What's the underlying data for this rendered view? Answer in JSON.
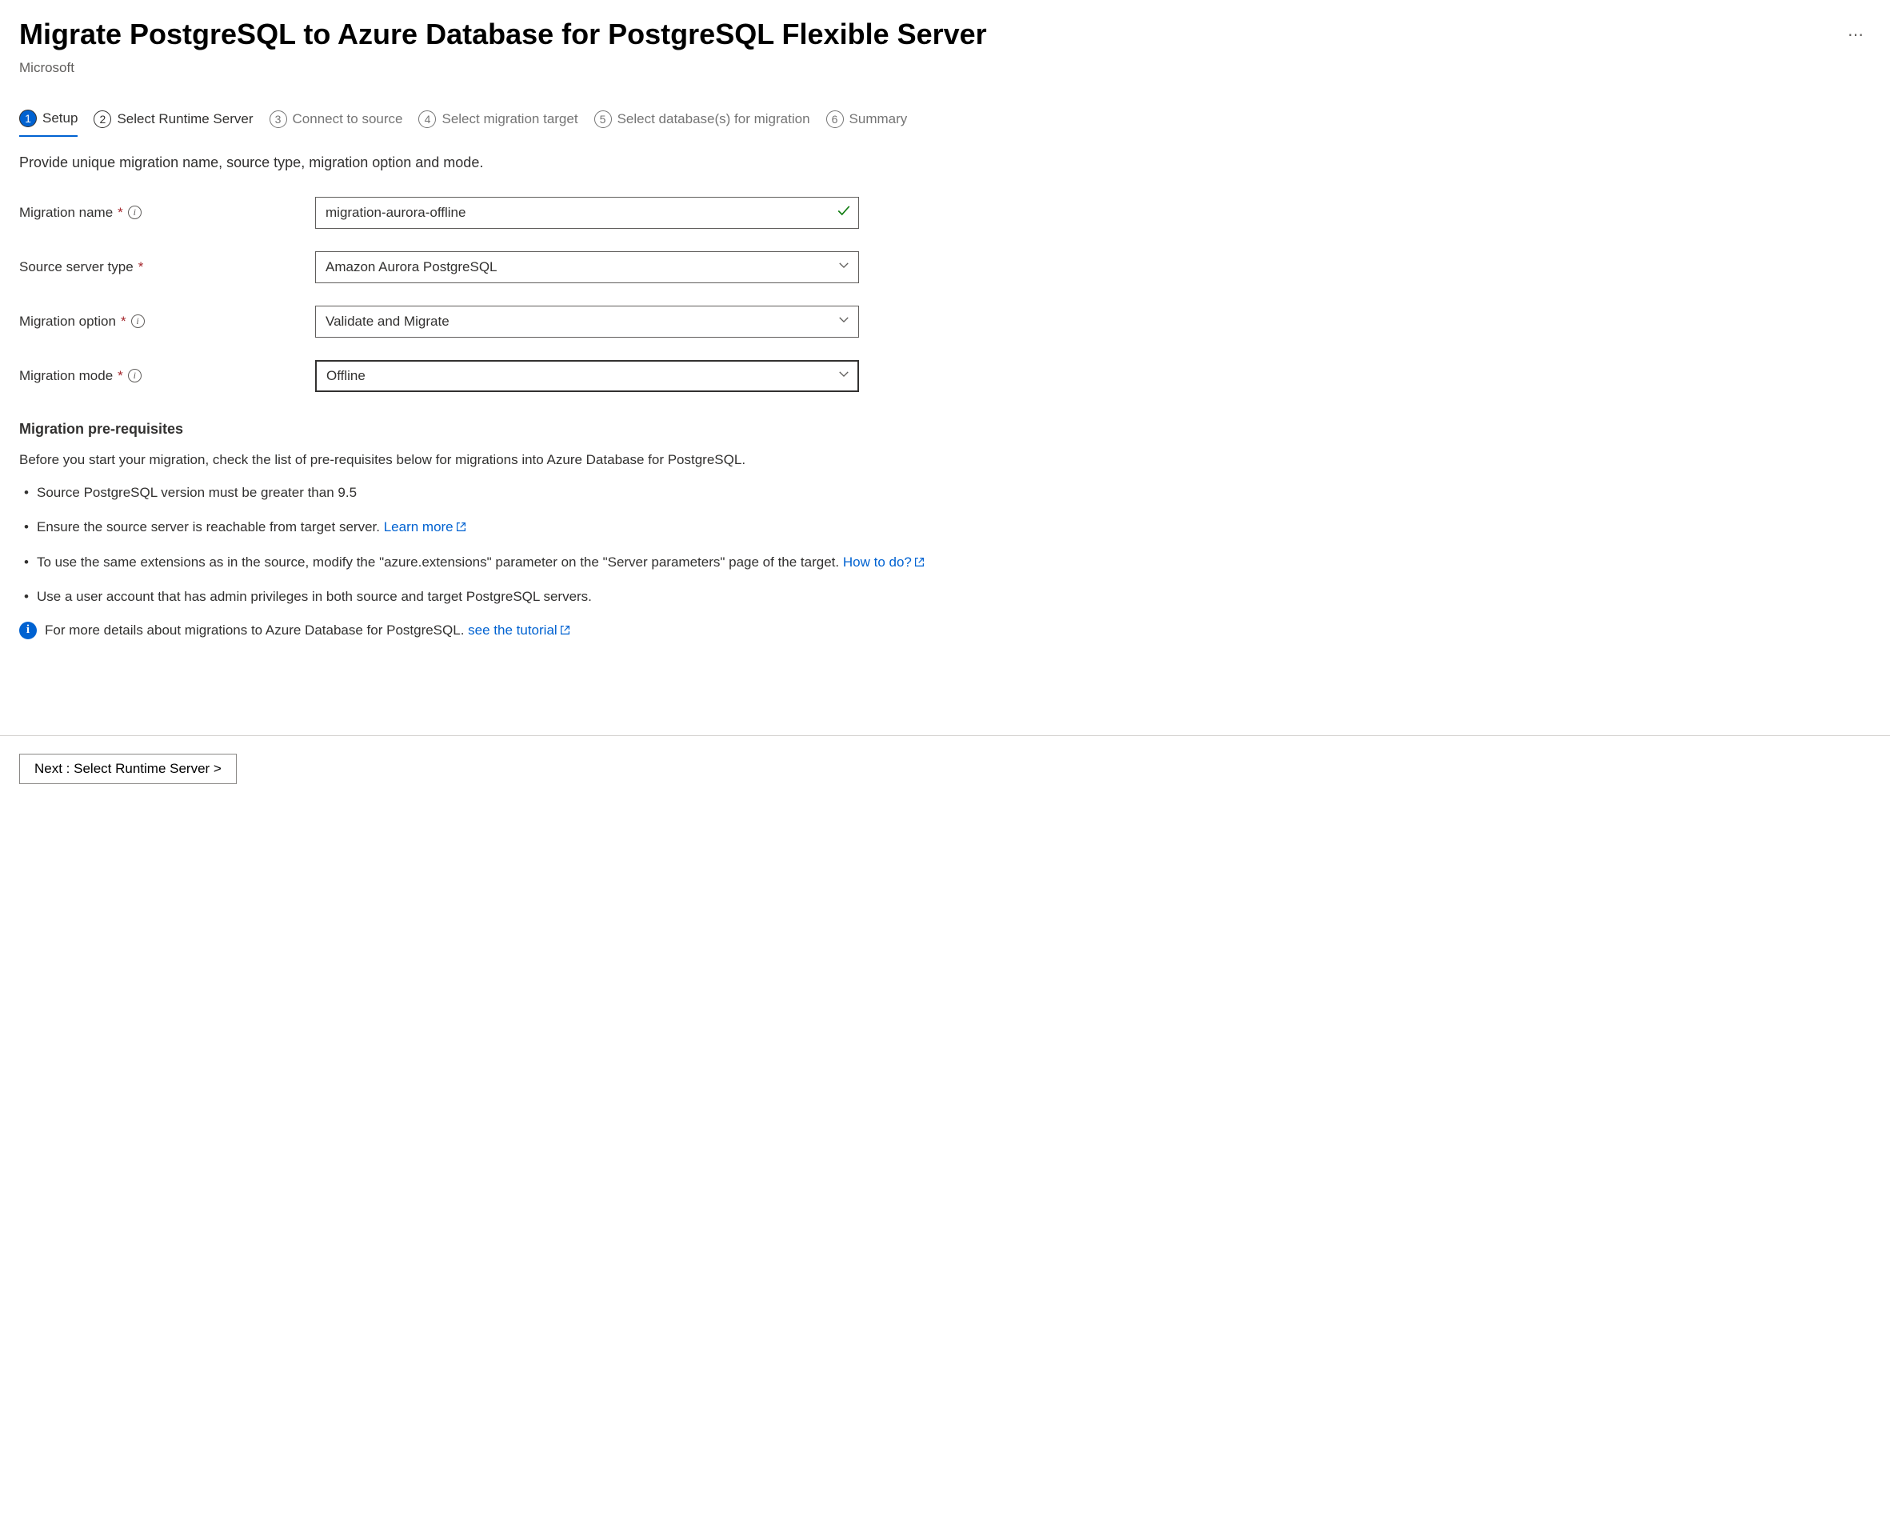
{
  "header": {
    "title": "Migrate PostgreSQL to Azure Database for PostgreSQL Flexible Server",
    "subtitle": "Microsoft"
  },
  "tabs": [
    {
      "num": "1",
      "label": "Setup"
    },
    {
      "num": "2",
      "label": "Select Runtime Server"
    },
    {
      "num": "3",
      "label": "Connect to source"
    },
    {
      "num": "4",
      "label": "Select migration target"
    },
    {
      "num": "5",
      "label": "Select database(s) for migration"
    },
    {
      "num": "6",
      "label": "Summary"
    }
  ],
  "description": "Provide unique migration name, source type, migration option and mode.",
  "form": {
    "migration_name_label": "Migration name",
    "migration_name_value": "migration-aurora-offline",
    "source_type_label": "Source server type",
    "source_type_value": "Amazon Aurora PostgreSQL",
    "migration_option_label": "Migration option",
    "migration_option_value": "Validate and Migrate",
    "migration_mode_label": "Migration mode",
    "migration_mode_value": "Offline"
  },
  "prereq": {
    "heading": "Migration pre-requisites",
    "intro": "Before you start your migration, check the list of pre-requisites below for migrations into Azure Database for PostgreSQL.",
    "item1": "Source PostgreSQL version must be greater than 9.5",
    "item2a": "Ensure the source server is reachable from target server. ",
    "item2_link": "Learn more",
    "item3a": "To use the same extensions as in the source, modify the \"azure.extensions\" parameter on the \"Server parameters\" page of the target. ",
    "item3_link": "How to do?",
    "item4": "Use a user account that has admin privileges in both source and target PostgreSQL servers.",
    "info_text": "For more details about migrations to Azure Database for PostgreSQL. ",
    "info_link": "see the tutorial"
  },
  "footer": {
    "next_label": "Next : Select Runtime Server >"
  }
}
